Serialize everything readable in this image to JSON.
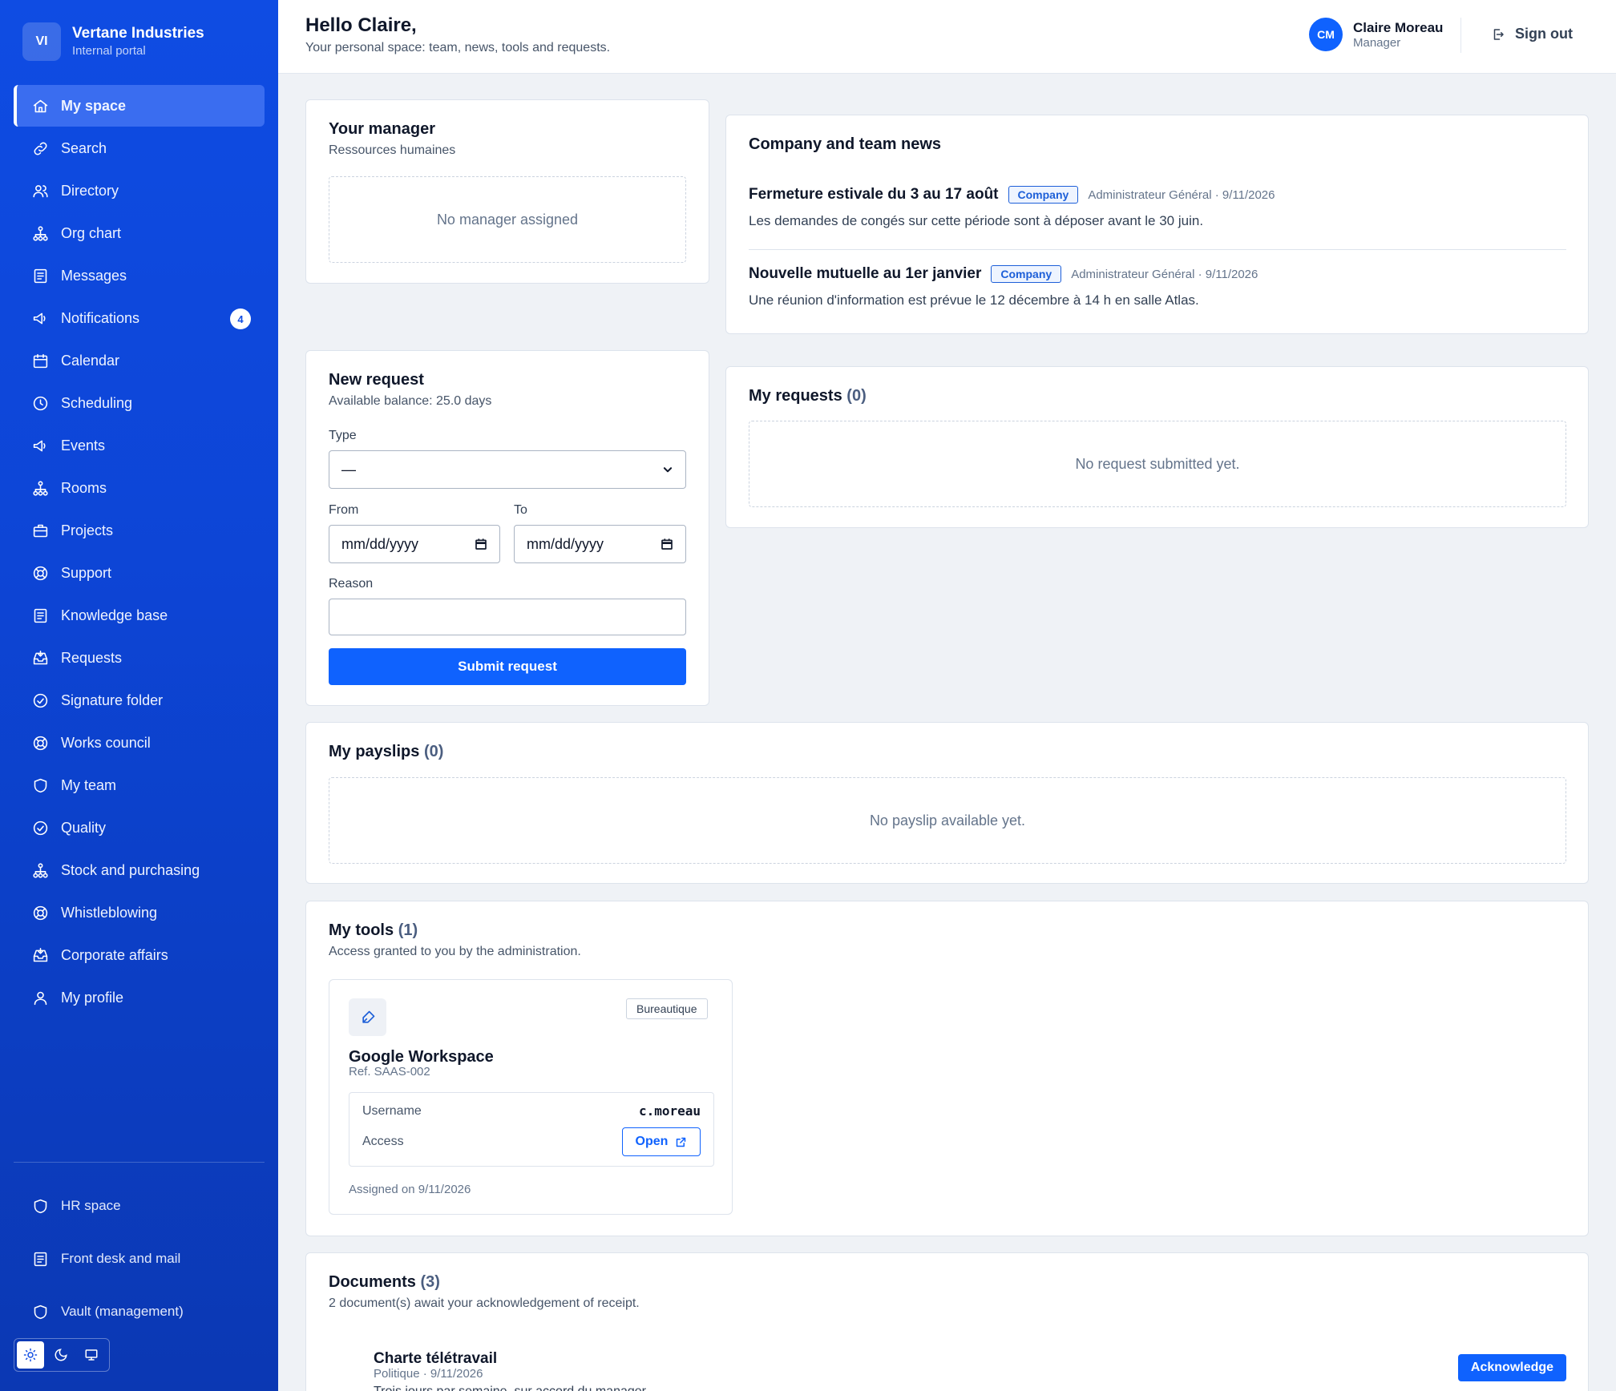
{
  "brand": {
    "initials": "VI",
    "name": "Vertane Industries",
    "subtitle": "Internal portal"
  },
  "sidebar": {
    "items": [
      {
        "label": "My space",
        "icon": "home-icon",
        "active": true
      },
      {
        "label": "Search",
        "icon": "link-icon"
      },
      {
        "label": "Directory",
        "icon": "users-icon"
      },
      {
        "label": "Org chart",
        "icon": "org-chart-icon"
      },
      {
        "label": "Messages",
        "icon": "document-icon"
      },
      {
        "label": "Notifications",
        "icon": "megaphone-icon",
        "badge": "4"
      },
      {
        "label": "Calendar",
        "icon": "calendar-icon"
      },
      {
        "label": "Scheduling",
        "icon": "clock-icon"
      },
      {
        "label": "Events",
        "icon": "megaphone-icon"
      },
      {
        "label": "Rooms",
        "icon": "org-chart-icon"
      },
      {
        "label": "Projects",
        "icon": "briefcase-icon"
      },
      {
        "label": "Support",
        "icon": "lifebuoy-icon"
      },
      {
        "label": "Knowledge base",
        "icon": "document-icon"
      },
      {
        "label": "Requests",
        "icon": "inbox-icon"
      },
      {
        "label": "Signature folder",
        "icon": "check-circle-icon"
      },
      {
        "label": "Works council",
        "icon": "lifebuoy-icon"
      },
      {
        "label": "My team",
        "icon": "shield-icon"
      },
      {
        "label": "Quality",
        "icon": "check-circle-icon"
      },
      {
        "label": "Stock and purchasing",
        "icon": "org-chart-icon"
      },
      {
        "label": "Whistleblowing",
        "icon": "lifebuoy-icon"
      },
      {
        "label": "Corporate affairs",
        "icon": "inbox-icon"
      },
      {
        "label": "My profile",
        "icon": "user-icon"
      }
    ],
    "bottom": [
      {
        "label": "HR space",
        "icon": "shield-icon"
      },
      {
        "label": "Front desk and mail",
        "icon": "document-icon"
      },
      {
        "label": "Vault (management)",
        "icon": "shield-icon"
      }
    ],
    "theme": {
      "active": "light",
      "options": [
        "sun-icon",
        "moon-icon",
        "monitor-icon"
      ]
    }
  },
  "header": {
    "greeting": "Hello Claire,",
    "subtitle": "Your personal space: team, news, tools and requests.",
    "user": {
      "initials": "CM",
      "name": "Claire Moreau",
      "role": "Manager"
    },
    "signout_label": "Sign out"
  },
  "manager": {
    "title": "Your manager",
    "department": "Ressources humaines",
    "empty": "No manager assigned"
  },
  "news": {
    "title": "Company and team news",
    "items": [
      {
        "title": "Fermeture estivale du 3 au 17 août",
        "tag": "Company",
        "meta": "Administrateur Général · 9/11/2026",
        "body": "Les demandes de congés sur cette période sont à déposer avant le 30 juin."
      },
      {
        "title": "Nouvelle mutuelle au 1er janvier",
        "tag": "Company",
        "meta": "Administrateur Général · 9/11/2026",
        "body": "Une réunion d'information est prévue le 12 décembre à 14 h en salle Atlas."
      }
    ]
  },
  "new_request": {
    "title": "New request",
    "balance": "Available balance: 25.0 days",
    "type_label": "Type",
    "type_value": "—",
    "from_label": "From",
    "to_label": "To",
    "date_placeholder": "mm/dd/yyyy",
    "reason_label": "Reason",
    "reason_value": "",
    "submit_label": "Submit request"
  },
  "my_requests": {
    "title": "My requests",
    "count": "(0)",
    "empty": "No request submitted yet."
  },
  "payslips": {
    "title": "My payslips",
    "count": "(0)",
    "empty": "No payslip available yet."
  },
  "tools": {
    "title": "My tools",
    "count": "(1)",
    "subtitle": "Access granted to you by the administration.",
    "items": [
      {
        "name": "Google Workspace",
        "ref": "Ref. SAAS-002",
        "category": "Bureautique",
        "icon": "pen-icon",
        "username_label": "Username",
        "username": "c.moreau",
        "access_label": "Access",
        "open_label": "Open",
        "assigned": "Assigned on 9/11/2026"
      }
    ]
  },
  "documents": {
    "title": "Documents",
    "count": "(3)",
    "subtitle": "2 document(s) await your acknowledgement of receipt.",
    "items": [
      {
        "name": "Charte télétravail",
        "meta": "Politique · 9/11/2026",
        "body": "Trois jours par semaine, sur accord du manager.",
        "action": "Acknowledge"
      }
    ]
  },
  "colors": {
    "sidebar": "#0f4ce3",
    "accent": "#0f62fe",
    "background": "#eff2f6"
  }
}
